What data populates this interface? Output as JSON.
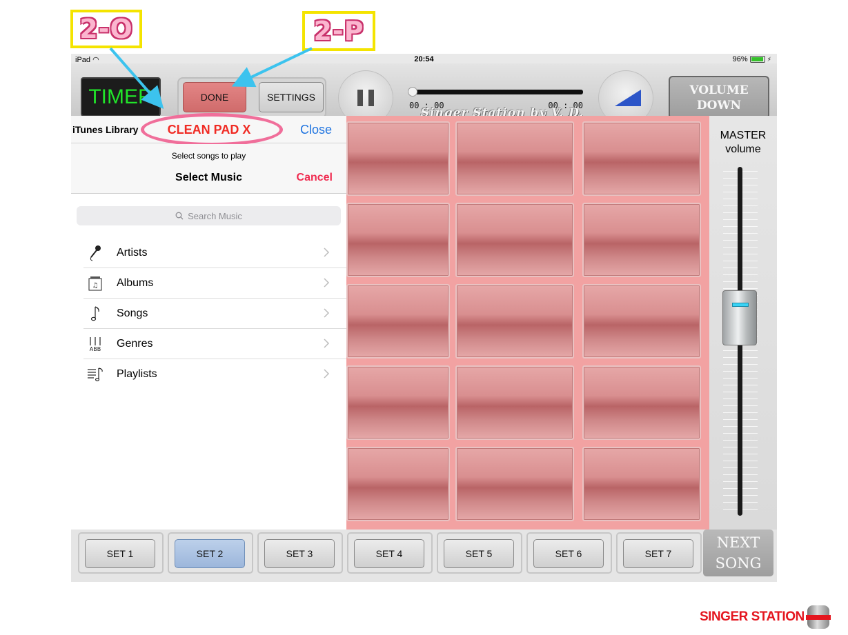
{
  "annotations": {
    "callout_left": "2-O",
    "callout_right": "2-P"
  },
  "status_bar": {
    "device": "iPad",
    "time": "20:54",
    "battery": "96%"
  },
  "toolbar": {
    "timer_label": "TIMER",
    "done_label": "DONE",
    "settings_label": "SETTINGS",
    "time_elapsed": "00 : 00",
    "time_total": "00 : 00",
    "brand_script": "Singer Station by V. D.",
    "volume_down_line1": "VOLUME",
    "volume_down_line2": "DOWN",
    "progress": 0
  },
  "picker": {
    "library_label": "iTunes Library",
    "pad_title": "CLEAN PAD X",
    "close_label": "Close",
    "prompt": "Select songs to play",
    "title": "Select Music",
    "cancel_label": "Cancel",
    "search_placeholder": "Search Music",
    "items": [
      {
        "label": "Artists",
        "icon": "microphone-icon"
      },
      {
        "label": "Albums",
        "icon": "album-icon"
      },
      {
        "label": "Songs",
        "icon": "music-note-icon"
      },
      {
        "label": "Genres",
        "icon": "genres-icon"
      },
      {
        "label": "Playlists",
        "icon": "playlist-icon"
      }
    ],
    "bottom_tabs": [
      {
        "icon": "music-note-icon",
        "selected": true
      },
      {
        "icon": "microphone-icon",
        "selected": false
      }
    ]
  },
  "master": {
    "label_line1": "MASTER",
    "label_line2": "volume",
    "level": 0.58
  },
  "sets": [
    {
      "label": "SET 1",
      "active": false
    },
    {
      "label": "SET 2",
      "active": true
    },
    {
      "label": "SET 3",
      "active": false
    },
    {
      "label": "SET 4",
      "active": false
    },
    {
      "label": "SET 5",
      "active": false
    },
    {
      "label": "SET 6",
      "active": false
    },
    {
      "label": "SET 7",
      "active": false
    }
  ],
  "next_song": {
    "line1": "NEXT",
    "line2": "SONG"
  },
  "footer": {
    "logo_text": "SINGER STATION"
  },
  "colors": {
    "accent_red": "#f02b24",
    "link_blue": "#1f74e0",
    "timer_green": "#21e52a",
    "annotation_pink": "#f06e9a",
    "annotation_yellow": "#f4e400"
  }
}
